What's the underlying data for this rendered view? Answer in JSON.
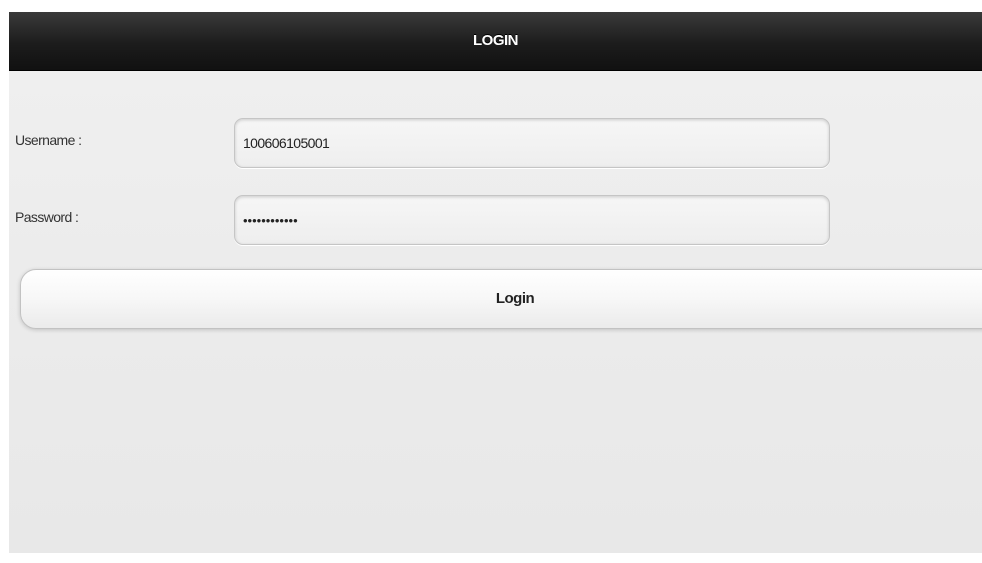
{
  "header": {
    "title": "LOGIN"
  },
  "form": {
    "username_label": "Username :",
    "username_value": "100606105001",
    "password_label": "Password :",
    "password_value": "••••••••••••",
    "login_label": "Login"
  }
}
